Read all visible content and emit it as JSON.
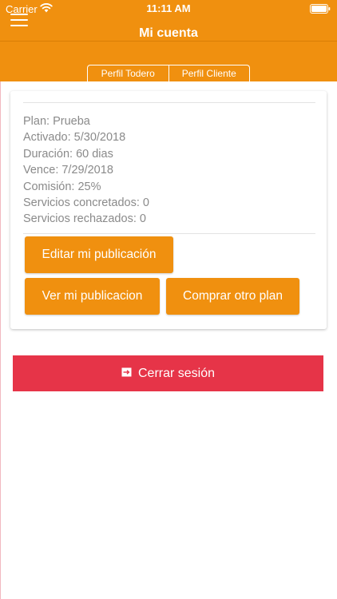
{
  "status_bar": {
    "carrier": "Carrier",
    "time": "11:11 AM",
    "wifi_icon": "wifi-icon",
    "battery_icon": "battery-icon"
  },
  "header": {
    "title": "Mi cuenta",
    "menu_icon": "hamburger-menu-icon",
    "background_color": "#F0900F"
  },
  "tabs": [
    {
      "label": "Perfil Todero"
    },
    {
      "label": "Perfil Cliente"
    }
  ],
  "plan_info": {
    "plan": "Plan: Prueba",
    "activated": "Activado: 5/30/2018",
    "duration": "Duración: 60 dias",
    "expires": "Vence: 7/29/2018",
    "commission": "Comisión: 25%",
    "services_completed": "Servicios concretados: 0",
    "services_rejected": "Servicios rechazados: 0"
  },
  "actions": {
    "edit_publication": "Editar mi publicación",
    "view_publication": "Ver mi publicacion",
    "buy_plan": "Comprar otro plan",
    "button_color": "#F0900F"
  },
  "logout": {
    "label": "Cerrar sesión",
    "icon": "logout-icon",
    "color": "#E63448"
  }
}
